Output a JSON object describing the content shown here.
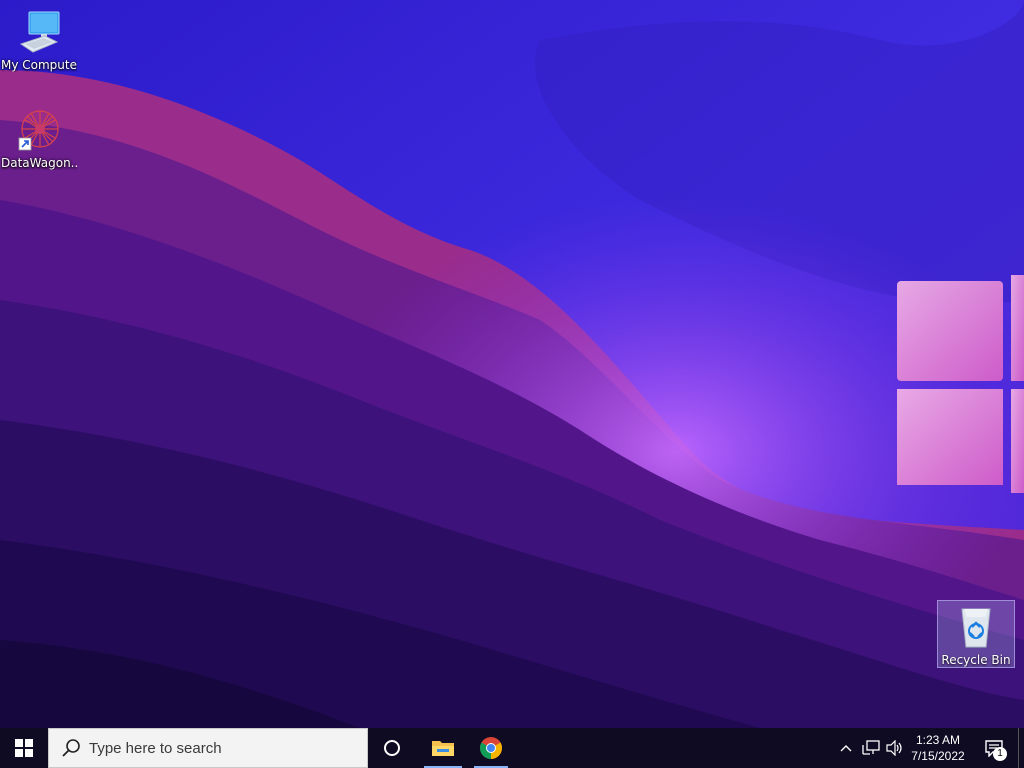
{
  "desktop": {
    "icons": [
      {
        "label": "My Computer",
        "icon": "computer-icon"
      },
      {
        "label": "DataWagon...",
        "icon": "datawagon-shortcut-icon"
      },
      {
        "label": "Recycle Bin",
        "icon": "recycle-bin-icon"
      }
    ]
  },
  "taskbar": {
    "search_placeholder": "Type here to search",
    "pinned": [
      {
        "name": "File Explorer",
        "icon": "folder-icon"
      },
      {
        "name": "Google Chrome",
        "icon": "chrome-icon"
      }
    ],
    "tray": {
      "time": "1:23 AM",
      "date": "7/15/2022",
      "notification_count": "1"
    }
  },
  "colors": {
    "taskbar_bg": "#0e0b22",
    "search_bg": "#f3f3f3",
    "active_indicator": "#8ab4f8",
    "wallpaper_top": "#3a24d8",
    "wallpaper_pink": "#c43fa5"
  }
}
